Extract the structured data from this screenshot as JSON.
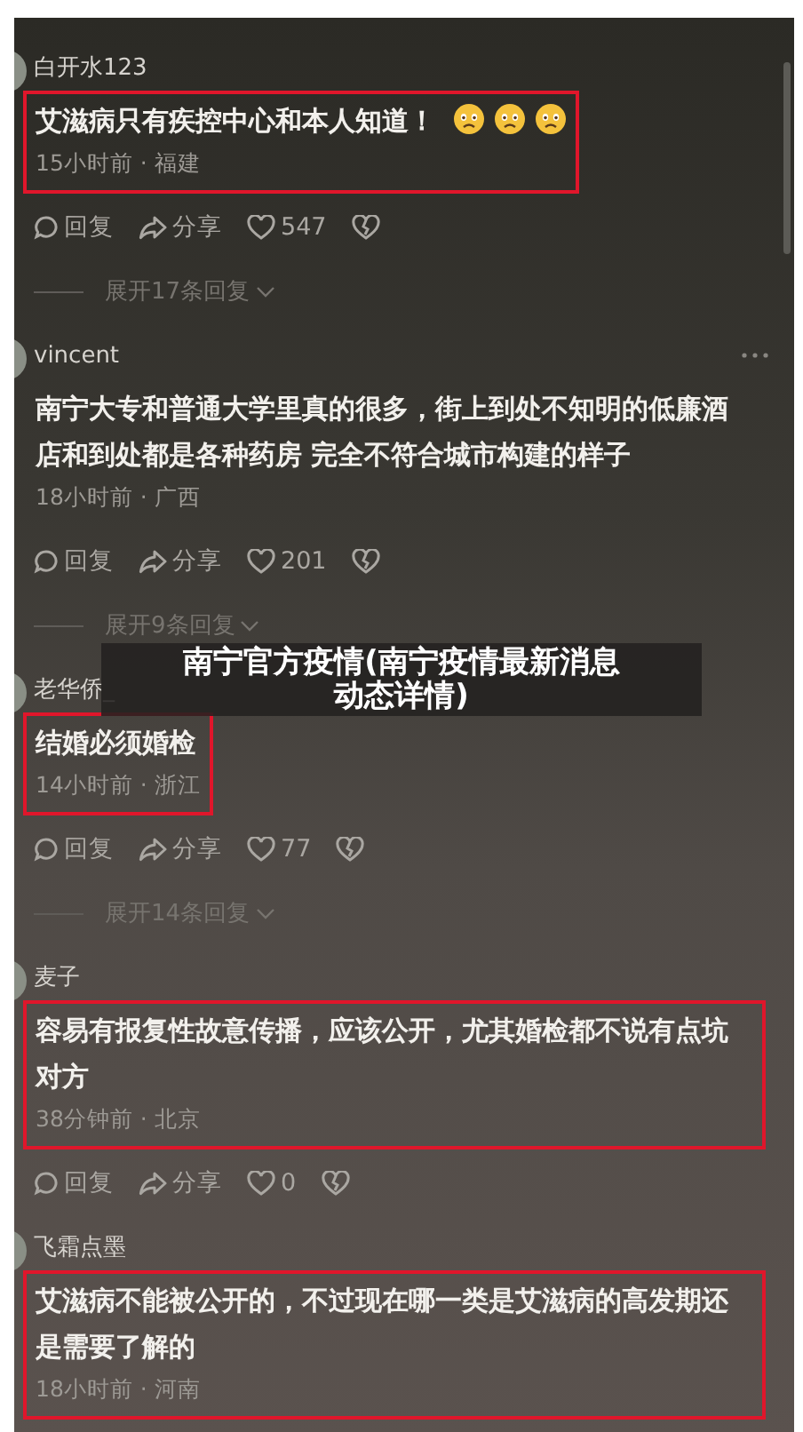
{
  "overlay_title": [
    "南宁官方疫情(南宁疫情最新消息",
    "动态详情)"
  ],
  "comments": [
    {
      "username": "白开水123",
      "text": "艾滋病只有疾控中心和本人知道！",
      "trailing_icons": [
        {
          "kind": "emoji"
        },
        {
          "kind": "emoji"
        },
        {
          "kind": "emoji"
        }
      ],
      "meta": "15小时前 · 福建",
      "highlighted": true,
      "has_menu": false,
      "reply_label": "回复",
      "share_label": "分享",
      "likes": "547",
      "expand_label": "展开17条回复"
    },
    {
      "username": "vincent",
      "text": "南宁大专和普通大学里真的很多，街上到处不知明的低廉酒店和到处都是各种药房 完全不符合城市构建的样子",
      "meta": "18小时前 · 广西",
      "highlighted": false,
      "has_menu": true,
      "reply_label": "回复",
      "share_label": "分享",
      "likes": "201",
      "expand_label": "展开9条回复"
    },
    {
      "username": "老华侨_",
      "text": "结婚必须婚检",
      "meta": "14小时前 · 浙江",
      "highlighted": true,
      "has_menu": false,
      "reply_label": "回复",
      "share_label": "分享",
      "likes": "77",
      "expand_label": "展开14条回复"
    },
    {
      "username": "麦子",
      "text": "容易有报复性故意传播，应该公开，尤其婚检都不说有点坑对方",
      "meta": "38分钟前 · 北京",
      "highlighted": true,
      "has_menu": false,
      "reply_label": "回复",
      "share_label": "分享",
      "likes": "0"
    },
    {
      "username": "飞霜点墨",
      "text": "艾滋病不能被公开的，不过现在哪一类是艾滋病的高发期还是需要了解的",
      "meta": "18小时前 · 河南",
      "highlighted": true,
      "has_menu": false
    }
  ]
}
